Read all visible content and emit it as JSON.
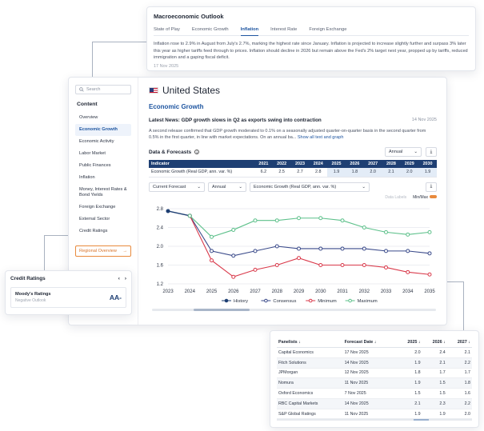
{
  "top": {
    "title": "Macroeconomic Outlook",
    "tabs": [
      "State of Play",
      "Economic Growth",
      "Inflation",
      "Interest Rate",
      "Foreign Exchange"
    ],
    "active_tab": "Inflation",
    "text": "Inflation rose to 2.9% in August from July's 2.7%, marking the highest rate since January. Inflation is projected to increase slightly further and surpass 3% later this year as higher tariffs feed through to prices. Inflation should decline in 2026 but remain above the Fed's 2% target next year, propped up by tariffs, reduced immigration and a gaping fiscal deficit.",
    "date": "17 Nov 2025"
  },
  "sidebar": {
    "search_placeholder": "Search",
    "heading": "Content",
    "items": [
      "Overview",
      "Economic Growth",
      "Economic Activity",
      "Labor Market",
      "Public Finances",
      "Inflation",
      "Money, Interest Rates & Bond Yields",
      "Foreign Exchange",
      "External Sector",
      "Credit Ratings"
    ],
    "active": "Economic Growth",
    "regional_button": "Regional Overview",
    "regional_arrow": "→"
  },
  "main": {
    "country": "United States",
    "section": "Economic Growth",
    "news_title": "Latest News: GDP growth slows in Q2 as exports swing into contraction",
    "news_date": "14 Nov 2025",
    "news_text": "A second release confirmed that GDP growth moderated to 0.1% on a seasonally adjusted quarter-on-quarter basis in the second quarter from 0.5% in the first quarter, in line with market expectations. On an annual ba...",
    "news_link": "Show all text and graph",
    "df_title": "Data & Forecasts",
    "df_select": "Annual",
    "indicator_header": "Indicator",
    "years": [
      "2021",
      "2022",
      "2023",
      "2024",
      "2025",
      "2026",
      "2027",
      "2028",
      "2029",
      "2030"
    ],
    "indicator_name": "Economic Growth (Real GDP, ann. var. %)",
    "indicator_values": [
      "6.2",
      "2.5",
      "2.7",
      "2.8",
      "1.9",
      "1.8",
      "2.0",
      "2.1",
      "2.0",
      "1.9"
    ],
    "ctrl_forecast": "Current Forecast",
    "ctrl_freq": "Annual",
    "ctrl_indicator": "Economic Growth (Real GDP, ann. var. %)",
    "data_labels": "Data Labels",
    "minmax": "Min/Max"
  },
  "chart_data": {
    "type": "line",
    "x": [
      2023,
      2024,
      2025,
      2026,
      2027,
      2028,
      2029,
      2030,
      2031,
      2032,
      2033,
      2034,
      2035
    ],
    "ylim": [
      1.2,
      2.8
    ],
    "yticks": [
      "2.8",
      "2.4",
      "2.0",
      "1.6",
      "1.2"
    ],
    "series": [
      {
        "name": "History",
        "color": "#1e3f73",
        "values": [
          2.75,
          2.65,
          null,
          null,
          null,
          null,
          null,
          null,
          null,
          null,
          null,
          null,
          null
        ]
      },
      {
        "name": "Consensus",
        "color": "#3a4a8a",
        "values": [
          null,
          2.65,
          1.9,
          1.8,
          1.9,
          2.0,
          1.95,
          1.95,
          1.95,
          1.95,
          1.9,
          1.9,
          1.85
        ]
      },
      {
        "name": "Minimum",
        "color": "#d9394a",
        "values": [
          null,
          2.65,
          1.7,
          1.35,
          1.5,
          1.6,
          1.75,
          1.6,
          1.6,
          1.6,
          1.55,
          1.45,
          1.4
        ]
      },
      {
        "name": "Maximum",
        "color": "#5cc08a",
        "values": [
          null,
          2.65,
          2.2,
          2.35,
          2.55,
          2.55,
          2.6,
          2.6,
          2.55,
          2.4,
          2.3,
          2.25,
          2.3
        ]
      }
    ]
  },
  "credit": {
    "title": "Credit Ratings",
    "nav_prev": "‹",
    "nav_next": "›",
    "agency": "Moody's Ratings",
    "outlook": "Negative Outlook",
    "rating": "AA-"
  },
  "panel": {
    "headers": [
      "Panelists ↓",
      "Forecast Date ↓",
      "2025 ↓",
      "2026 ↓",
      "2027 ↓"
    ],
    "rows": [
      [
        "Capital Economics",
        "17 Nov 2025",
        "2.0",
        "2.4",
        "2.1"
      ],
      [
        "Fitch Solutions",
        "14 Nov 2025",
        "1.9",
        "2.1",
        "2.2"
      ],
      [
        "JPMorgan",
        "12 Nov 2025",
        "1.8",
        "1.7",
        "1.7"
      ],
      [
        "Nomura",
        "11 Nov 2025",
        "1.9",
        "1.5",
        "1.8"
      ],
      [
        "Oxford Economics",
        "7 Nov 2025",
        "1.5",
        "1.5",
        "1.6"
      ],
      [
        "RBC Capital Markets",
        "14 Nov 2025",
        "2.1",
        "2.3",
        "2.2"
      ],
      [
        "S&P Global Ratings",
        "11 Nov 2025",
        "1.9",
        "1.9",
        "2.0"
      ]
    ]
  }
}
